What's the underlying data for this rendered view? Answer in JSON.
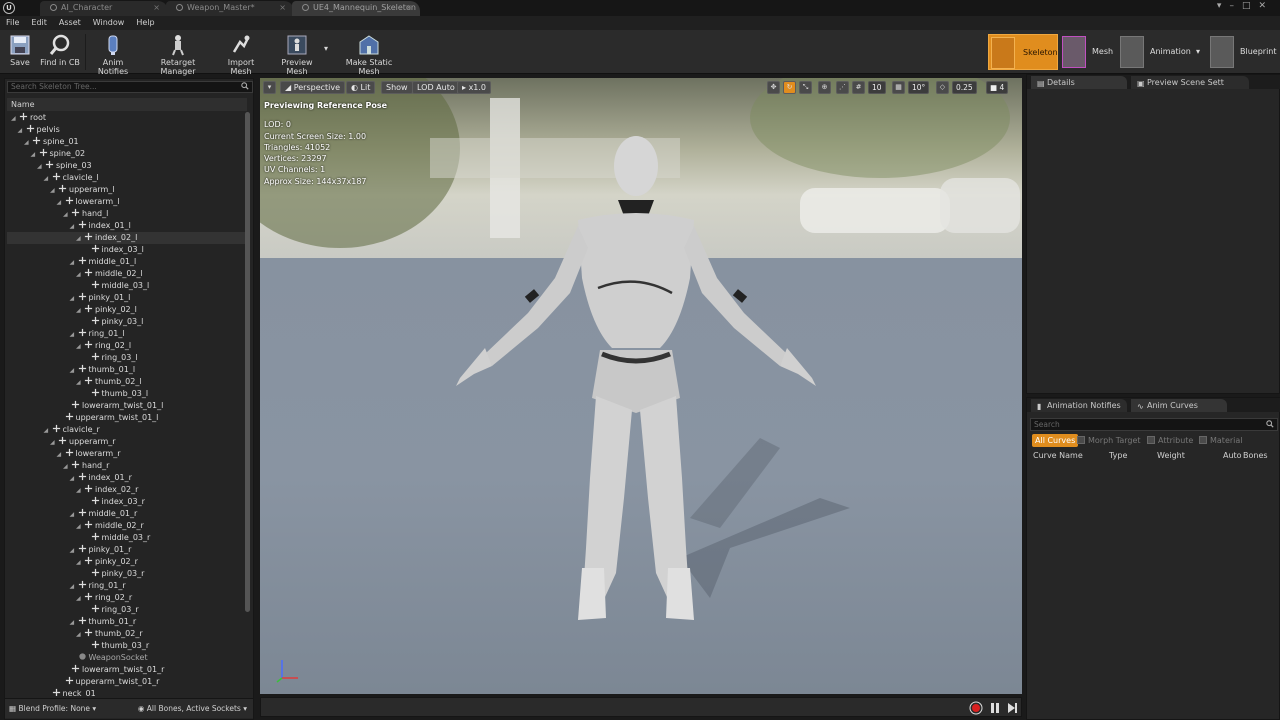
{
  "window": {
    "tabs": [
      {
        "label": "AI_Character"
      },
      {
        "label": "Weapon_Master*"
      },
      {
        "label": "UE4_Mannequin_Skeleton"
      }
    ]
  },
  "menu": [
    "File",
    "Edit",
    "Asset",
    "Window",
    "Help"
  ],
  "toolbar": {
    "save": "Save",
    "find_in_cb": "Find in CB",
    "anim_notifies": "Anim Notifies",
    "retarget_manager": "Retarget Manager",
    "import_mesh": "Import Mesh",
    "preview_mesh": "Preview Mesh",
    "make_static_mesh": "Make Static Mesh"
  },
  "modes": {
    "skeleton": "Skeleton",
    "mesh": "Mesh",
    "animation": "Animation",
    "blueprint": "Blueprint"
  },
  "skeleton_tree": {
    "search_placeholder": "Search Skeleton Tree...",
    "column": "Name",
    "rows": [
      {
        "label": "root",
        "depth": 0
      },
      {
        "label": "pelvis",
        "depth": 1
      },
      {
        "label": "spine_01",
        "depth": 2
      },
      {
        "label": "spine_02",
        "depth": 3
      },
      {
        "label": "spine_03",
        "depth": 4
      },
      {
        "label": "clavicle_l",
        "depth": 5
      },
      {
        "label": "upperarm_l",
        "depth": 6
      },
      {
        "label": "lowerarm_l",
        "depth": 7
      },
      {
        "label": "hand_l",
        "depth": 8
      },
      {
        "label": "index_01_l",
        "depth": 9
      },
      {
        "label": "index_02_l",
        "depth": 10
      },
      {
        "label": "index_03_l",
        "depth": 11
      },
      {
        "label": "middle_01_l",
        "depth": 9
      },
      {
        "label": "middle_02_l",
        "depth": 10
      },
      {
        "label": "middle_03_l",
        "depth": 11
      },
      {
        "label": "pinky_01_l",
        "depth": 9
      },
      {
        "label": "pinky_02_l",
        "depth": 10
      },
      {
        "label": "pinky_03_l",
        "depth": 11
      },
      {
        "label": "ring_01_l",
        "depth": 9
      },
      {
        "label": "ring_02_l",
        "depth": 10
      },
      {
        "label": "ring_03_l",
        "depth": 11
      },
      {
        "label": "thumb_01_l",
        "depth": 9
      },
      {
        "label": "thumb_02_l",
        "depth": 10
      },
      {
        "label": "thumb_03_l",
        "depth": 11
      },
      {
        "label": "lowerarm_twist_01_l",
        "depth": 8
      },
      {
        "label": "upperarm_twist_01_l",
        "depth": 7
      },
      {
        "label": "clavicle_r",
        "depth": 5
      },
      {
        "label": "upperarm_r",
        "depth": 6
      },
      {
        "label": "lowerarm_r",
        "depth": 7
      },
      {
        "label": "hand_r",
        "depth": 8
      },
      {
        "label": "index_01_r",
        "depth": 9
      },
      {
        "label": "index_02_r",
        "depth": 10
      },
      {
        "label": "index_03_r",
        "depth": 11
      },
      {
        "label": "middle_01_r",
        "depth": 9
      },
      {
        "label": "middle_02_r",
        "depth": 10
      },
      {
        "label": "middle_03_r",
        "depth": 11
      },
      {
        "label": "pinky_01_r",
        "depth": 9
      },
      {
        "label": "pinky_02_r",
        "depth": 10
      },
      {
        "label": "pinky_03_r",
        "depth": 11
      },
      {
        "label": "ring_01_r",
        "depth": 9
      },
      {
        "label": "ring_02_r",
        "depth": 10
      },
      {
        "label": "ring_03_r",
        "depth": 11
      },
      {
        "label": "thumb_01_r",
        "depth": 9
      },
      {
        "label": "thumb_02_r",
        "depth": 10
      },
      {
        "label": "thumb_03_r",
        "depth": 11
      },
      {
        "label": "WeaponSocket",
        "depth": 9,
        "socket": true
      },
      {
        "label": "lowerarm_twist_01_r",
        "depth": 8
      },
      {
        "label": "upperarm_twist_01_r",
        "depth": 7
      },
      {
        "label": "neck_01",
        "depth": 5
      }
    ],
    "selected_row": "index_02_l",
    "blend_profile": "Blend Profile: None",
    "bones_filter": "All Bones, Active Sockets"
  },
  "viewport": {
    "perspective": "Perspective",
    "lit": "Lit",
    "show": "Show",
    "lod": "LOD Auto",
    "speed": "x1.0",
    "grid_snap": "10",
    "rot_snap": "10°",
    "scale_snap": "0.25",
    "camera_speed": "4",
    "info_title": "Previewing Reference Pose",
    "info_lines": [
      "LOD: 0",
      "Current Screen Size: 1.00",
      "Triangles: 41052",
      "Vertices: 23297",
      "UV Channels: 1",
      "Approx Size: 144x37x187"
    ]
  },
  "details": {
    "tab_details": "Details",
    "tab_preview": "Preview Scene Sett"
  },
  "curves": {
    "tab_notifies": "Animation Notifies",
    "tab_curves": "Anim Curves",
    "search_placeholder": "Search",
    "filter_all": "All Curves",
    "filter_morph": "Morph Target",
    "filter_attribute": "Attribute",
    "filter_material": "Material",
    "col_name": "Curve Name",
    "col_type": "Type",
    "col_weight": "Weight",
    "col_auto": "Auto",
    "col_bones": "Bones"
  },
  "colors": {
    "accent": "#e08d1e",
    "panel": "#262626"
  }
}
